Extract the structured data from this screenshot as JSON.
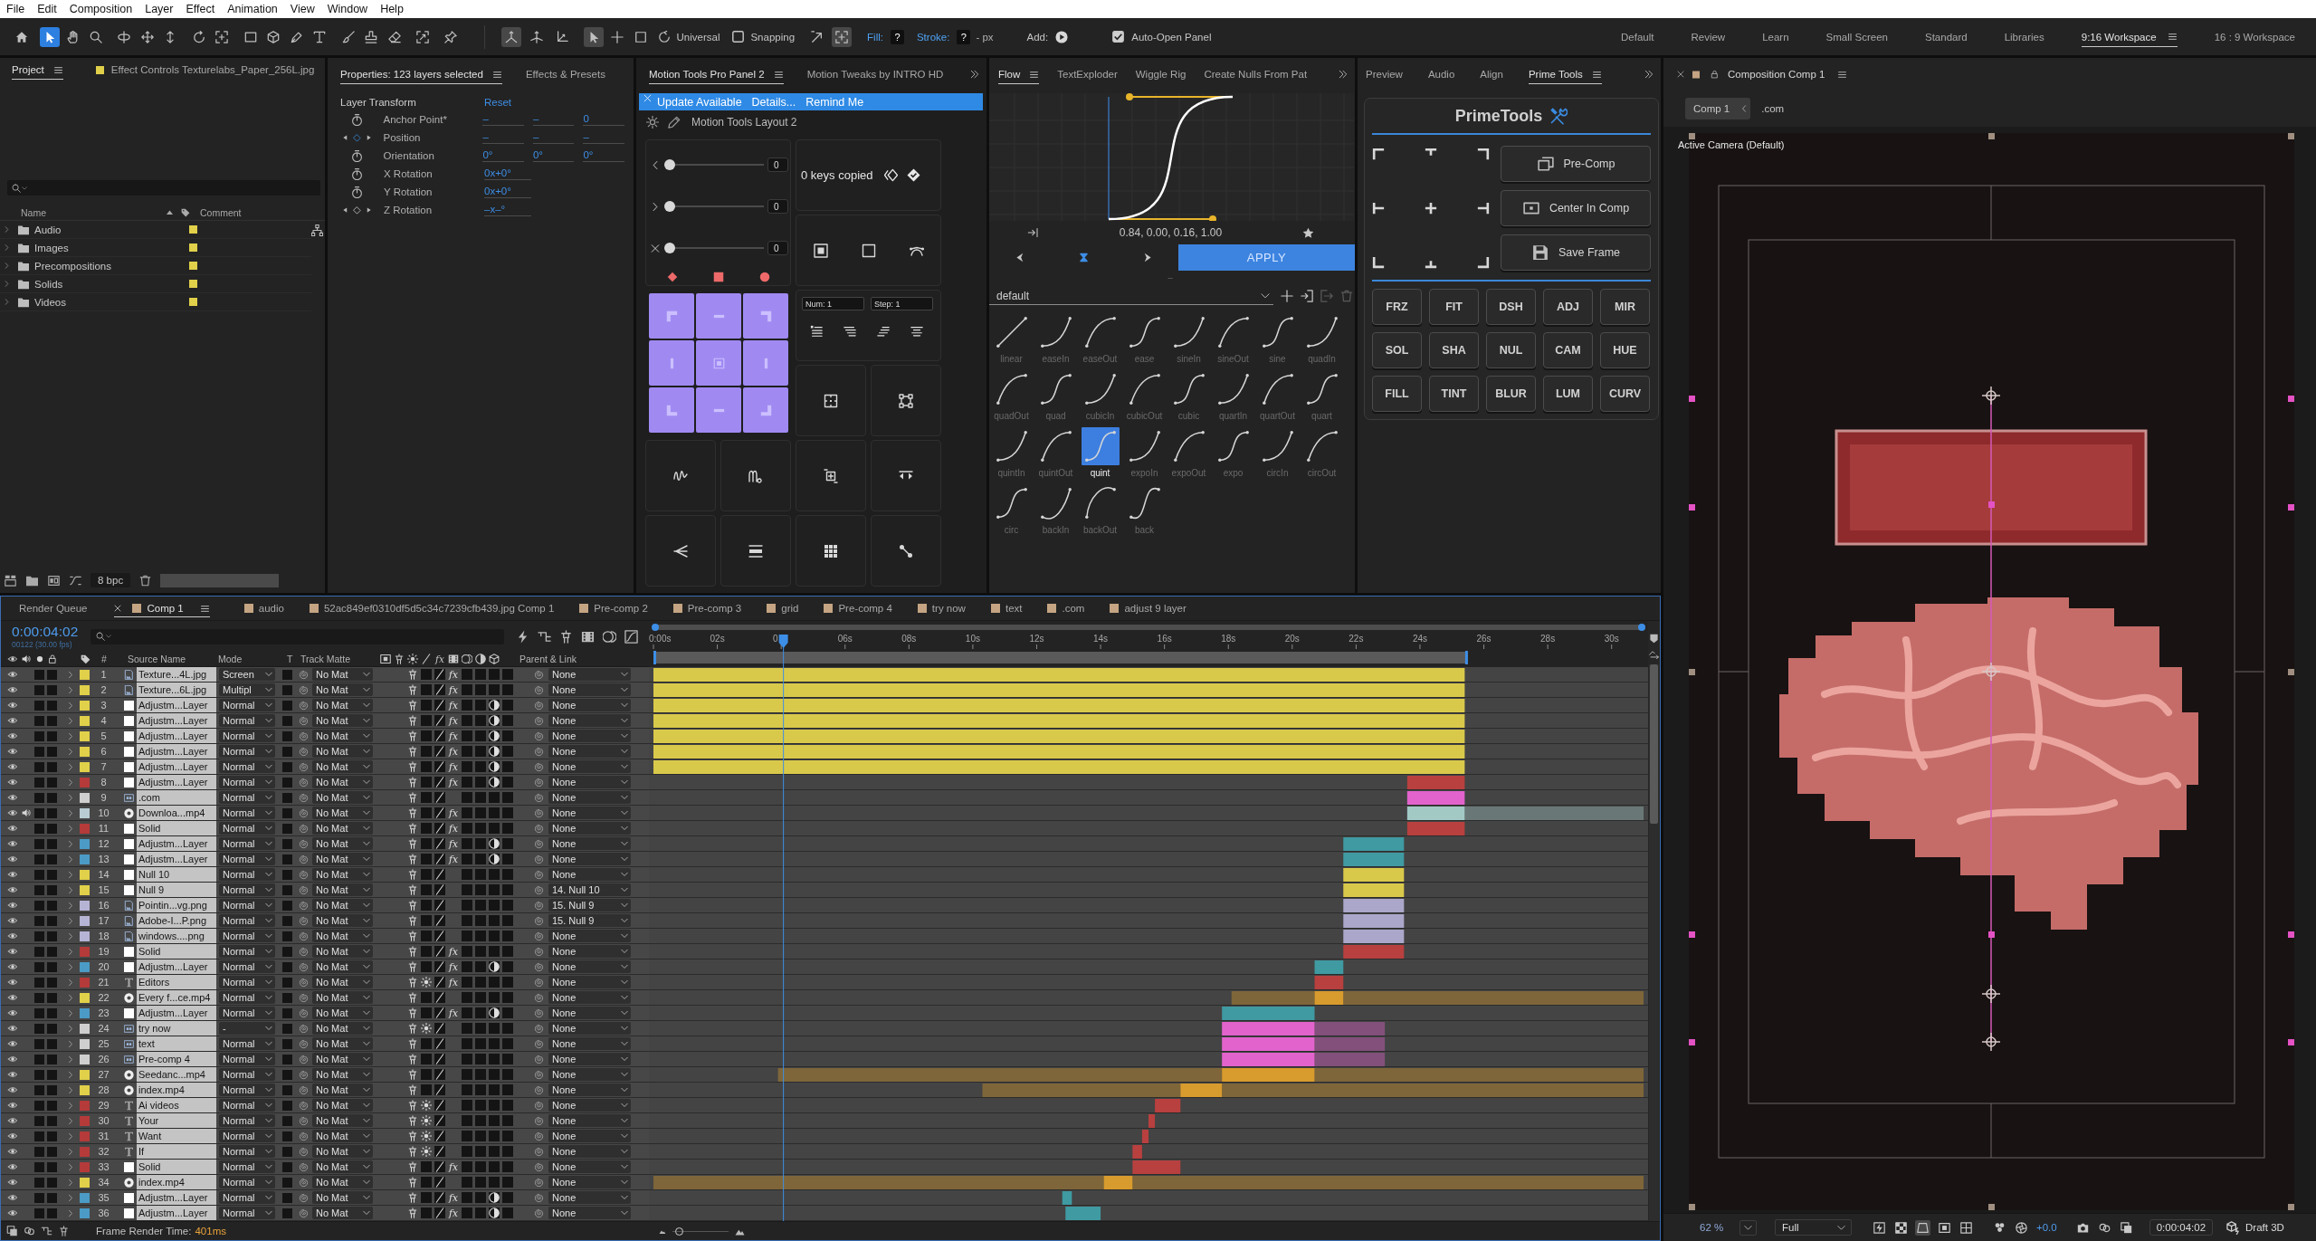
{
  "menu_bar": {
    "items": [
      "File",
      "Edit",
      "Composition",
      "Layer",
      "Effect",
      "Animation",
      "View",
      "Window",
      "Help"
    ]
  },
  "toolbar": {
    "tools": [
      {
        "kind": "home",
        "selected": false
      },
      {
        "kind": "selection",
        "selected": true
      },
      {
        "kind": "hand",
        "selected": false
      },
      {
        "kind": "zoom",
        "selected": false
      },
      {
        "kind": "orbit",
        "selected": false
      },
      {
        "kind": "pan",
        "selected": false
      },
      {
        "kind": "dolly",
        "selected": false
      },
      {
        "kind": "rotate",
        "selected": false
      },
      {
        "kind": "anchor",
        "selected": false
      },
      {
        "kind": "rectangle",
        "selected": false
      },
      {
        "kind": "cube",
        "selected": false
      },
      {
        "kind": "pen",
        "selected": false
      },
      {
        "kind": "type",
        "selected": false
      },
      {
        "kind": "brush",
        "selected": false
      },
      {
        "kind": "stamp",
        "selected": false
      },
      {
        "kind": "eraser",
        "selected": false
      },
      {
        "kind": "roto",
        "selected": false
      },
      {
        "kind": "pin",
        "selected": false
      }
    ],
    "axis_tools": [
      {
        "kind": "local-axis",
        "selected": true
      },
      {
        "kind": "world-axis",
        "selected": false
      },
      {
        "kind": "view-axis",
        "selected": false
      }
    ],
    "gizmo_tools": [
      {
        "kind": "arrow",
        "selected": true
      },
      {
        "kind": "move",
        "selected": false
      },
      {
        "kind": "scale",
        "selected": false
      },
      {
        "kind": "rotate-gizmo",
        "selected": false
      }
    ],
    "gizmo_mode": "Universal",
    "snapping": {
      "label": "Snapping",
      "checked": false
    },
    "snap_tools": [
      {
        "kind": "snap-arrow",
        "selected": false
      },
      {
        "kind": "snap-target",
        "selected": true
      }
    ],
    "fill": {
      "label": "Fill:",
      "value": "?"
    },
    "stroke": {
      "label": "Stroke:",
      "value": "?",
      "width": "- px"
    },
    "add_label": "Add:",
    "auto_open": {
      "label": "Auto-Open Panel",
      "checked": true
    }
  },
  "workspaces": [
    {
      "label": "Default",
      "selected": false
    },
    {
      "label": "Review",
      "selected": false
    },
    {
      "label": "Learn",
      "selected": false
    },
    {
      "label": "Small Screen",
      "selected": false
    },
    {
      "label": "Standard",
      "selected": false
    },
    {
      "label": "Libraries",
      "selected": false
    },
    {
      "label": "9:16 Workspace",
      "selected": true
    },
    {
      "label": "16 : 9 Workspace",
      "selected": false
    }
  ],
  "project": {
    "tabs": [
      {
        "label": "Project",
        "kind": "panel",
        "selected": true
      },
      {
        "label": "Effect Controls Texturelabs_Paper_256L.jpg",
        "kind": "layer",
        "selected": false
      }
    ],
    "columns": [
      "Name",
      "Comment"
    ],
    "items": [
      {
        "name": "Audio",
        "color": "#e0d04a"
      },
      {
        "name": "Images",
        "color": "#e0d04a"
      },
      {
        "name": "Precompositions",
        "color": "#e0d04a"
      },
      {
        "name": "Solids",
        "color": "#e0d04a"
      },
      {
        "name": "Videos",
        "color": "#e0d04a"
      }
    ],
    "bit_depth": "8 bpc"
  },
  "properties": {
    "tabs": [
      {
        "label": "Properties: 123 layers selected",
        "selected": true
      },
      {
        "label": "Effects & Presets",
        "selected": false
      }
    ],
    "section": "Layer Transform",
    "reset": "Reset",
    "rows": [
      {
        "kind": "stopwatch",
        "label": "Anchor Point*",
        "values": [
          "–",
          "–",
          "0"
        ]
      },
      {
        "kind": "keyframes",
        "label": "Position",
        "keyed": true,
        "values": [
          "–",
          "–",
          "–"
        ]
      },
      {
        "kind": "stopwatch",
        "label": "Orientation",
        "values": [
          "0°",
          "0°",
          "0°"
        ]
      },
      {
        "kind": "stopwatch",
        "label": "X Rotation",
        "values": [
          "0x+0°"
        ]
      },
      {
        "kind": "stopwatch",
        "label": "Y Rotation",
        "values": [
          "0x+0°"
        ]
      },
      {
        "kind": "keyframes",
        "label": "Z Rotation",
        "keyed": false,
        "values": [
          "–x–°"
        ]
      }
    ]
  },
  "motion_tools": {
    "tabs": [
      {
        "label": "Motion Tools Pro Panel 2",
        "selected": true
      },
      {
        "label": "Motion Tweaks by INTRO HD",
        "selected": false
      }
    ],
    "update_bar": {
      "message": "Update Available",
      "links": [
        "Details...",
        "Remind Me"
      ]
    },
    "layout_name": "Motion Tools Layout 2",
    "sliders": [
      {
        "kind": "ease-in",
        "value": "0",
        "level": 0
      },
      {
        "kind": "ease-out",
        "value": "0",
        "level": 0
      },
      {
        "kind": "both",
        "value": "0",
        "level": 0
      }
    ],
    "keys_copied": "0 keys copied",
    "fields": [
      "Num: 1",
      "Step: 1"
    ]
  },
  "flow": {
    "tabs": [
      {
        "label": "Flow",
        "selected": true
      },
      {
        "label": "TextExploder",
        "selected": false
      },
      {
        "label": "Wiggle Rig",
        "selected": false
      },
      {
        "label": "Create Nulls From Pat",
        "selected": false
      }
    ],
    "bezier": "0.84, 0.00, 0.16, 1.00",
    "apply": "APPLY",
    "library": "default",
    "presets": [
      {
        "label": "linear",
        "kind": "linear",
        "selected": false
      },
      {
        "label": "easeIn",
        "kind": "in",
        "selected": false
      },
      {
        "label": "easeOut",
        "kind": "out",
        "selected": false
      },
      {
        "label": "ease",
        "kind": "inout",
        "selected": false
      },
      {
        "label": "sineIn",
        "kind": "in",
        "selected": false
      },
      {
        "label": "sineOut",
        "kind": "out",
        "selected": false
      },
      {
        "label": "sine",
        "kind": "inout",
        "selected": false
      },
      {
        "label": "quadIn",
        "kind": "in",
        "selected": false
      },
      {
        "label": "quadOut",
        "kind": "out",
        "selected": false
      },
      {
        "label": "quad",
        "kind": "inout",
        "selected": false
      },
      {
        "label": "cubicIn",
        "kind": "in",
        "selected": false
      },
      {
        "label": "cubicOut",
        "kind": "out",
        "selected": false
      },
      {
        "label": "cubic",
        "kind": "inout",
        "selected": false
      },
      {
        "label": "quartIn",
        "kind": "in",
        "selected": false
      },
      {
        "label": "quartOut",
        "kind": "out",
        "selected": false
      },
      {
        "label": "quart",
        "kind": "inout",
        "selected": false
      },
      {
        "label": "quintIn",
        "kind": "in",
        "selected": false
      },
      {
        "label": "quintOut",
        "kind": "out",
        "selected": false
      },
      {
        "label": "quint",
        "kind": "inout",
        "selected": true
      },
      {
        "label": "expoIn",
        "kind": "in",
        "selected": false
      },
      {
        "label": "expoOut",
        "kind": "out",
        "selected": false
      },
      {
        "label": "expo",
        "kind": "inout",
        "selected": false
      },
      {
        "label": "circIn",
        "kind": "in",
        "selected": false
      },
      {
        "label": "circOut",
        "kind": "out",
        "selected": false
      },
      {
        "label": "circ",
        "kind": "inout",
        "selected": false
      },
      {
        "label": "backIn",
        "kind": "back-in",
        "selected": false
      },
      {
        "label": "backOut",
        "kind": "back-out",
        "selected": false
      },
      {
        "label": "back",
        "kind": "back-inout",
        "selected": false
      }
    ]
  },
  "prime_tools": {
    "tabs": [
      {
        "label": "Preview",
        "selected": false
      },
      {
        "label": "Audio",
        "selected": false
      },
      {
        "label": "Align",
        "selected": false
      },
      {
        "label": "Prime Tools",
        "selected": true
      }
    ],
    "title": "PrimeTools",
    "actions": [
      {
        "kind": "precomp",
        "label": "Pre-Comp"
      },
      {
        "kind": "center",
        "label": "Center In Comp"
      },
      {
        "kind": "save",
        "label": "Save Frame"
      }
    ],
    "shortcuts": [
      "FRZ",
      "FIT",
      "DSH",
      "ADJ",
      "MIR",
      "SOL",
      "SHA",
      "NUL",
      "CAM",
      "HUE",
      "FILL",
      "TINT",
      "BLUR",
      "LUM",
      "CURV"
    ]
  },
  "composition": {
    "tab": "Composition Comp 1",
    "breadcrumbs": [
      {
        "label": "Comp 1",
        "selected": true
      },
      {
        "label": ".com",
        "selected": false
      }
    ],
    "camera": "Active Camera (Default)",
    "zoom": "62 %",
    "resolution": "Full",
    "exposure": "+0.0",
    "timecode": "0:00:04:02",
    "renderer": "Draft 3D"
  },
  "timeline": {
    "tabs": [
      {
        "label": "Render Queue",
        "kind": "queue",
        "selected": false
      },
      {
        "label": "Comp 1",
        "kind": "comp",
        "selected": true
      },
      {
        "label": "audio",
        "kind": "comp",
        "selected": false
      },
      {
        "label": "52ac849ef0310df5d5c34c7239cfb439.jpg Comp 1",
        "kind": "comp",
        "selected": false
      },
      {
        "label": "Pre-comp 2",
        "kind": "comp",
        "selected": false
      },
      {
        "label": "Pre-comp 3",
        "kind": "comp",
        "selected": false
      },
      {
        "label": "grid",
        "kind": "comp",
        "selected": false
      },
      {
        "label": "Pre-comp 4",
        "kind": "comp",
        "selected": false
      },
      {
        "label": "try now",
        "kind": "comp",
        "selected": false
      },
      {
        "label": "text",
        "kind": "comp",
        "selected": false
      },
      {
        "label": ".com",
        "kind": "comp",
        "selected": false
      },
      {
        "label": "adjust 9 layer",
        "kind": "comp",
        "selected": false
      }
    ],
    "timecode": "0:00:04:02",
    "frame_info": "00122 (30.00 fps)",
    "columns": {
      "number": "#",
      "source": "Source Name",
      "mode": "Mode",
      "preserve": "T",
      "matte": "Track Matte",
      "fx": "fx",
      "parent": "Parent & Link"
    },
    "ruler": [
      "0:00s",
      "02s",
      "0",
      "06s",
      "08s",
      "10s",
      "12s",
      "14s",
      "16s",
      "18s",
      "20s",
      "22s",
      "24s",
      "26s",
      "28s",
      "30s"
    ],
    "layers": [
      {
        "num": "1",
        "kind": "image",
        "name": "Texture...4L.jpg",
        "color": "#e0d04a",
        "mode": "Screen",
        "matte": "No Mat",
        "parent": "None",
        "fx": "fx",
        "adjustment": false,
        "collapse": false,
        "audio": false,
        "visible": true,
        "selected": true
      },
      {
        "num": "2",
        "kind": "image",
        "name": "Texture...6L.jpg",
        "color": "#e0d04a",
        "mode": "Multipl",
        "matte": "No Mat",
        "parent": "None",
        "fx": "fx",
        "adjustment": false,
        "collapse": false,
        "audio": false,
        "visible": true,
        "selected": true
      },
      {
        "num": "3",
        "kind": "solid",
        "name": "Adjustm...Layer",
        "color": "#e0d04a",
        "mode": "Normal",
        "matte": "No Mat",
        "parent": "None",
        "fx": "fx",
        "adjustment": true,
        "collapse": false,
        "audio": false,
        "visible": true,
        "selected": true
      },
      {
        "num": "4",
        "kind": "solid",
        "name": "Adjustm...Layer",
        "color": "#e0d04a",
        "mode": "Normal",
        "matte": "No Mat",
        "parent": "None",
        "fx": "fx",
        "adjustment": true,
        "collapse": false,
        "audio": false,
        "visible": true,
        "selected": true
      },
      {
        "num": "5",
        "kind": "solid",
        "name": "Adjustm...Layer",
        "color": "#e0d04a",
        "mode": "Normal",
        "matte": "No Mat",
        "parent": "None",
        "fx": "fx",
        "adjustment": true,
        "collapse": false,
        "audio": false,
        "visible": true,
        "selected": true
      },
      {
        "num": "6",
        "kind": "solid",
        "name": "Adjustm...Layer",
        "color": "#e0d04a",
        "mode": "Normal",
        "matte": "No Mat",
        "parent": "None",
        "fx": "fx",
        "adjustment": true,
        "collapse": false,
        "audio": false,
        "visible": true,
        "selected": true
      },
      {
        "num": "7",
        "kind": "solid",
        "name": "Adjustm...Layer",
        "color": "#e0d04a",
        "mode": "Normal",
        "matte": "No Mat",
        "parent": "None",
        "fx": "fx",
        "adjustment": true,
        "collapse": false,
        "audio": false,
        "visible": true,
        "selected": true
      },
      {
        "num": "8",
        "kind": "solid",
        "name": "Adjustm...Layer",
        "color": "#b53a3a",
        "mode": "Normal",
        "matte": "No Mat",
        "parent": "None",
        "fx": "fx",
        "adjustment": true,
        "collapse": false,
        "audio": false,
        "visible": true,
        "selected": true
      },
      {
        "num": "9",
        "kind": "precomp",
        "name": ".com",
        "color": "#cfcfcf",
        "mode": "Normal",
        "matte": "No Mat",
        "parent": "None",
        "adjustment": false,
        "collapse": false,
        "audio": false,
        "visible": true,
        "selected": true
      },
      {
        "num": "10",
        "kind": "video",
        "name": "Downloa...mp4",
        "color": "#b9ccd3",
        "mode": "Normal",
        "matte": "No Mat",
        "parent": "None",
        "fx": "fx",
        "adjustment": false,
        "collapse": false,
        "audio": true,
        "visible": true,
        "selected": true
      },
      {
        "num": "11",
        "kind": "solid",
        "name": "Solid",
        "color": "#b53a3a",
        "mode": "Normal",
        "matte": "No Mat",
        "parent": "None",
        "fx": "fx",
        "adjustment": false,
        "collapse": false,
        "audio": false,
        "visible": true,
        "selected": true
      },
      {
        "num": "12",
        "kind": "solid",
        "name": "Adjustm...Layer",
        "color": "#4b9bc6",
        "mode": "Normal",
        "matte": "No Mat",
        "parent": "None",
        "fx": "fx",
        "adjustment": true,
        "collapse": false,
        "audio": false,
        "visible": true,
        "selected": true
      },
      {
        "num": "13",
        "kind": "solid",
        "name": "Adjustm...Layer",
        "color": "#4b9bc6",
        "mode": "Normal",
        "matte": "No Mat",
        "parent": "None",
        "fx": "fx",
        "adjustment": true,
        "collapse": false,
        "audio": false,
        "visible": true,
        "selected": true
      },
      {
        "num": "14",
        "kind": "solid",
        "name": "Null 10",
        "color": "#e0d04a",
        "mode": "Normal",
        "matte": "No Mat",
        "parent": "None",
        "adjustment": false,
        "collapse": false,
        "audio": false,
        "visible": true,
        "selected": true
      },
      {
        "num": "15",
        "kind": "solid",
        "name": "Null 9",
        "color": "#e0d04a",
        "mode": "Normal",
        "matte": "No Mat",
        "parent": "14. Null 10",
        "adjustment": false,
        "collapse": false,
        "audio": false,
        "visible": true,
        "selected": true
      },
      {
        "num": "16",
        "kind": "image",
        "name": "Pointin...vg.png",
        "color": "#b6b4d4",
        "mode": "Normal",
        "matte": "No Mat",
        "parent": "15. Null 9",
        "adjustment": false,
        "collapse": false,
        "audio": false,
        "visible": true,
        "selected": true
      },
      {
        "num": "17",
        "kind": "image",
        "name": "Adobe-I...P.png",
        "color": "#b6b4d4",
        "mode": "Normal",
        "matte": "No Mat",
        "parent": "15. Null 9",
        "adjustment": false,
        "collapse": false,
        "audio": false,
        "visible": true,
        "selected": true
      },
      {
        "num": "18",
        "kind": "image",
        "name": "windows....png",
        "color": "#b6b4d4",
        "mode": "Normal",
        "matte": "No Mat",
        "parent": "None",
        "adjustment": false,
        "collapse": false,
        "audio": false,
        "visible": true,
        "selected": true
      },
      {
        "num": "19",
        "kind": "solid",
        "name": "Solid",
        "color": "#b53a3a",
        "mode": "Normal",
        "matte": "No Mat",
        "parent": "None",
        "fx": "fx",
        "adjustment": false,
        "collapse": false,
        "audio": false,
        "visible": true,
        "selected": true
      },
      {
        "num": "20",
        "kind": "solid",
        "name": "Adjustm...Layer",
        "color": "#4b9bc6",
        "mode": "Normal",
        "matte": "No Mat",
        "parent": "None",
        "fx": "fx",
        "adjustment": true,
        "collapse": false,
        "audio": false,
        "visible": true,
        "selected": true
      },
      {
        "num": "21",
        "kind": "text",
        "name": "Editors",
        "color": "#b53a3a",
        "mode": "Normal",
        "matte": "No Mat",
        "parent": "None",
        "fx": "fx",
        "adjustment": false,
        "collapse": true,
        "audio": false,
        "visible": true,
        "selected": true
      },
      {
        "num": "22",
        "kind": "video",
        "name": "Every f...ce.mp4",
        "color": "#e0d04a",
        "mode": "Normal",
        "matte": "No Mat",
        "parent": "None",
        "adjustment": false,
        "collapse": false,
        "audio": false,
        "visible": true,
        "selected": true
      },
      {
        "num": "23",
        "kind": "solid",
        "name": "Adjustm...Layer",
        "color": "#4b9bc6",
        "mode": "Normal",
        "matte": "No Mat",
        "parent": "None",
        "fx": "fx",
        "adjustment": true,
        "collapse": false,
        "audio": false,
        "visible": true,
        "selected": true
      },
      {
        "num": "24",
        "kind": "precomp",
        "name": "try now",
        "color": "#cfcfcf",
        "mode": "-",
        "matte": "No Mat",
        "parent": "None",
        "adjustment": false,
        "collapse": true,
        "audio": false,
        "visible": true,
        "selected": true
      },
      {
        "num": "25",
        "kind": "precomp",
        "name": "text",
        "color": "#cfcfcf",
        "mode": "Normal",
        "matte": "No Mat",
        "parent": "None",
        "adjustment": false,
        "collapse": false,
        "audio": false,
        "visible": true,
        "selected": true
      },
      {
        "num": "26",
        "kind": "precomp",
        "name": "Pre-comp 4",
        "color": "#cfcfcf",
        "mode": "Normal",
        "matte": "No Mat",
        "parent": "None",
        "adjustment": false,
        "collapse": false,
        "audio": false,
        "visible": true,
        "selected": true
      },
      {
        "num": "27",
        "kind": "video",
        "name": "Seedanc...mp4",
        "color": "#e0d04a",
        "mode": "Normal",
        "matte": "No Mat",
        "parent": "None",
        "adjustment": false,
        "collapse": false,
        "audio": false,
        "visible": true,
        "selected": true
      },
      {
        "num": "28",
        "kind": "video",
        "name": "index.mp4",
        "color": "#e0d04a",
        "mode": "Normal",
        "matte": "No Mat",
        "parent": "None",
        "adjustment": false,
        "collapse": false,
        "audio": false,
        "visible": true,
        "selected": true
      },
      {
        "num": "29",
        "kind": "text",
        "name": "Ai videos",
        "color": "#b53a3a",
        "mode": "Normal",
        "matte": "No Mat",
        "parent": "None",
        "adjustment": false,
        "collapse": true,
        "audio": false,
        "visible": true,
        "selected": true
      },
      {
        "num": "30",
        "kind": "text",
        "name": "Your",
        "color": "#b53a3a",
        "mode": "Normal",
        "matte": "No Mat",
        "parent": "None",
        "adjustment": false,
        "collapse": true,
        "audio": false,
        "visible": true,
        "selected": true
      },
      {
        "num": "31",
        "kind": "text",
        "name": "Want",
        "color": "#b53a3a",
        "mode": "Normal",
        "matte": "No Mat",
        "parent": "None",
        "adjustment": false,
        "collapse": true,
        "audio": false,
        "visible": true,
        "selected": true
      },
      {
        "num": "32",
        "kind": "text",
        "name": "If",
        "color": "#b53a3a",
        "mode": "Normal",
        "matte": "No Mat",
        "parent": "None",
        "adjustment": false,
        "collapse": true,
        "audio": false,
        "visible": true,
        "selected": true
      },
      {
        "num": "33",
        "kind": "solid",
        "name": "Solid",
        "color": "#b53a3a",
        "mode": "Normal",
        "matte": "No Mat",
        "parent": "None",
        "fx": "fx",
        "adjustment": false,
        "collapse": false,
        "audio": false,
        "visible": true,
        "selected": true
      },
      {
        "num": "34",
        "kind": "video",
        "name": "index.mp4",
        "color": "#e0d04a",
        "mode": "Normal",
        "matte": "No Mat",
        "parent": "None",
        "adjustment": false,
        "collapse": false,
        "audio": false,
        "visible": true,
        "selected": true
      },
      {
        "num": "35",
        "kind": "solid",
        "name": "Adjustm...Layer",
        "color": "#4b9bc6",
        "mode": "Normal",
        "matte": "No Mat",
        "parent": "None",
        "fx": "fx",
        "adjustment": true,
        "collapse": false,
        "audio": false,
        "visible": true,
        "selected": true
      },
      {
        "num": "36",
        "kind": "solid",
        "name": "Adjustm...Layer",
        "color": "#4b9bc6",
        "mode": "Normal",
        "matte": "No Mat",
        "parent": "None",
        "fx": "fx",
        "adjustment": true,
        "collapse": false,
        "audio": false,
        "visible": true,
        "selected": true
      }
    ],
    "render_label": "Frame Render Time:",
    "render_time": "401ms",
    "zoom_slider": {
      "level": 0.05
    }
  }
}
